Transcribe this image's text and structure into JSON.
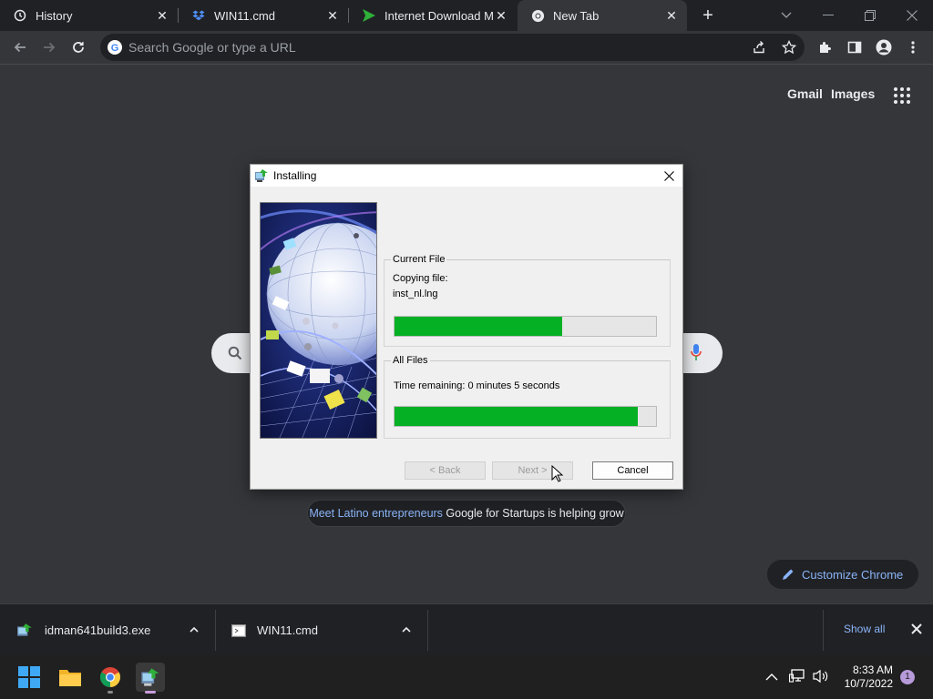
{
  "browser": {
    "tabs": [
      {
        "title": "History",
        "icon": "history-icon"
      },
      {
        "title": "WIN11.cmd",
        "icon": "dropbox-icon"
      },
      {
        "title": "Internet Download Ma",
        "icon": "idm-icon"
      },
      {
        "title": "New Tab",
        "icon": "chrome-icon"
      }
    ],
    "omnibox_placeholder": "Search Google or type a URL"
  },
  "ntp": {
    "links": {
      "gmail": "Gmail",
      "images": "Images"
    },
    "promo": {
      "link_text": "Meet Latino entrepreneurs",
      "rest_text": "Google for Startups is helping grow"
    },
    "customize_label": "Customize Chrome"
  },
  "dialog": {
    "title": "Installing",
    "current_file_group": "Current File",
    "copying_label": "Copying file:",
    "file_name": "inst_nl.lng",
    "current_progress_pct": 64,
    "all_files_group": "All Files",
    "time_remaining": "Time remaining: 0 minutes 5 seconds",
    "all_progress_pct": 93,
    "buttons": {
      "back": "< Back",
      "next": "Next >",
      "cancel": "Cancel"
    }
  },
  "downloads": {
    "items": [
      {
        "name": "idman641build3.exe",
        "icon": "idm-installer-icon"
      },
      {
        "name": "WIN11.cmd",
        "icon": "cmd-file-icon"
      }
    ],
    "show_all": "Show all"
  },
  "taskbar": {
    "time": "8:33 AM",
    "date": "10/7/2022",
    "notification_count": "1"
  },
  "colors": {
    "progress_green": "#06b025",
    "link_blue": "#8ab4f8"
  }
}
